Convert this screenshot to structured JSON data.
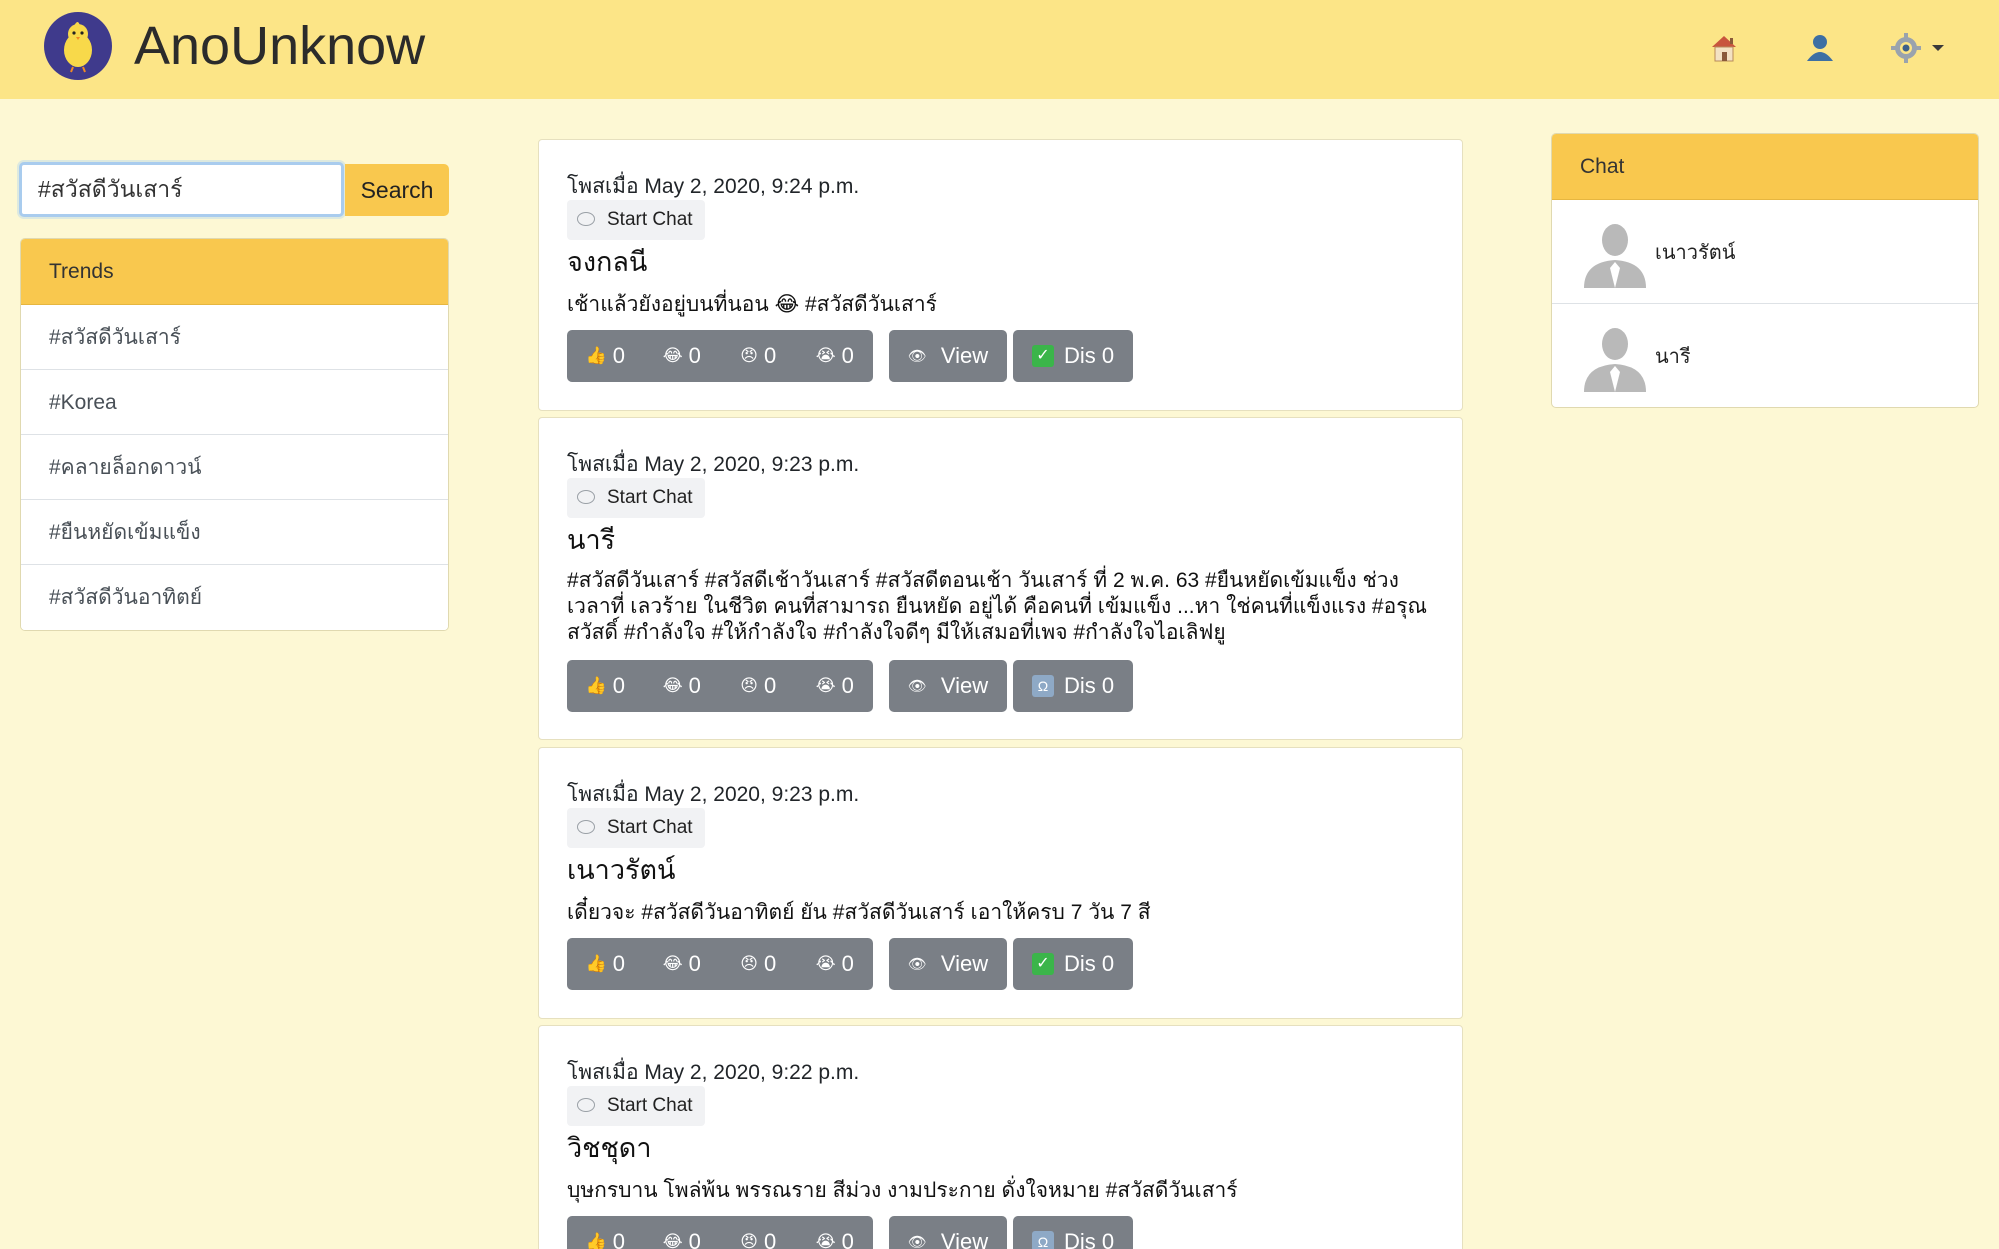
{
  "app": {
    "brand": "AnoUnknow"
  },
  "nav": {
    "home_icon": "home-icon",
    "user_icon": "user-icon",
    "settings_icon": "gear-icon"
  },
  "search": {
    "value": "#สวัสดีวันเสาร์",
    "button_label": "Search"
  },
  "trends": {
    "header": "Trends",
    "items": [
      {
        "label": "#สวัสดีวันเสาร์"
      },
      {
        "label": "#Korea"
      },
      {
        "label": "#คลายล็อกดาวน์"
      },
      {
        "label": "#ยืนหยัดเข้มแข็ง"
      },
      {
        "label": "#สวัสดีวันอาทิตย์"
      }
    ]
  },
  "posts": [
    {
      "meta": "โพสเมื่อ May 2, 2020, 9:24 p.m.",
      "start_chat": "Start Chat",
      "author": "จงกลนี",
      "body": "เช้าแล้วยังอยู่บนที่นอน 😂 #สวัสดีวันเสาร์",
      "reactions": [
        "0",
        "0",
        "0",
        "0"
      ],
      "view_label": "View",
      "dis_label": "Dis 0",
      "dis_icon": "check-icon"
    },
    {
      "meta": "โพสเมื่อ May 2, 2020, 9:23 p.m.",
      "start_chat": "Start Chat",
      "author": "นารี",
      "body": "#สวัสดีวันเสาร์ #สวัสดีเช้าวันเสาร์ #สวัสดีตอนเช้า วันเสาร์ ที่ 2 พ.ค. 63 #ยืนหยัดเข้มแข็ง ช่วงเวลาที่ เลวร้าย ในชีวิต คนที่สามารถ ยืนหยัด อยู่ได้ คือคนที่ เข้มแข็ง ...หา ใช่คนที่แข็งแรง #อรุณสวัสดิ์ #กำลังใจ #ให้กำลังใจ #กำลังใจดีๆ มีให้เสมอที่เพจ #กำลังใจไอเลิฟยู",
      "reactions": [
        "0",
        "0",
        "0",
        "0"
      ],
      "view_label": "View",
      "dis_label": "Dis 0",
      "dis_icon": "sign-icon"
    },
    {
      "meta": "โพสเมื่อ May 2, 2020, 9:23 p.m.",
      "start_chat": "Start Chat",
      "author": "เนาวรัตน์",
      "body": "เดี๋ยวจะ #สวัสดีวันอาทิตย์ ยัน #สวัสดีวันเสาร์ เอาให้ครบ 7 วัน 7 สี",
      "reactions": [
        "0",
        "0",
        "0",
        "0"
      ],
      "view_label": "View",
      "dis_label": "Dis 0",
      "dis_icon": "check-icon"
    },
    {
      "meta": "โพสเมื่อ May 2, 2020, 9:22 p.m.",
      "start_chat": "Start Chat",
      "author": "วิชชุดา",
      "body": "บุษกรบาน โพล่พ้น พรรณราย สีม่วง งามประกาย ดั่งใจหมาย #สวัสดีวันเสาร์",
      "reactions": [
        "0",
        "0",
        "0",
        "0"
      ],
      "view_label": "View",
      "dis_label": "Dis 0",
      "dis_icon": "sign-icon"
    }
  ],
  "chat": {
    "header": "Chat",
    "users": [
      {
        "name": "เนาวรัตน์"
      },
      {
        "name": "นารี"
      }
    ]
  },
  "colors": {
    "navbar": "#fce587",
    "page_bg": "#fdf8d4",
    "accent": "#f9c84e",
    "button_gray": "#7a7f86"
  }
}
